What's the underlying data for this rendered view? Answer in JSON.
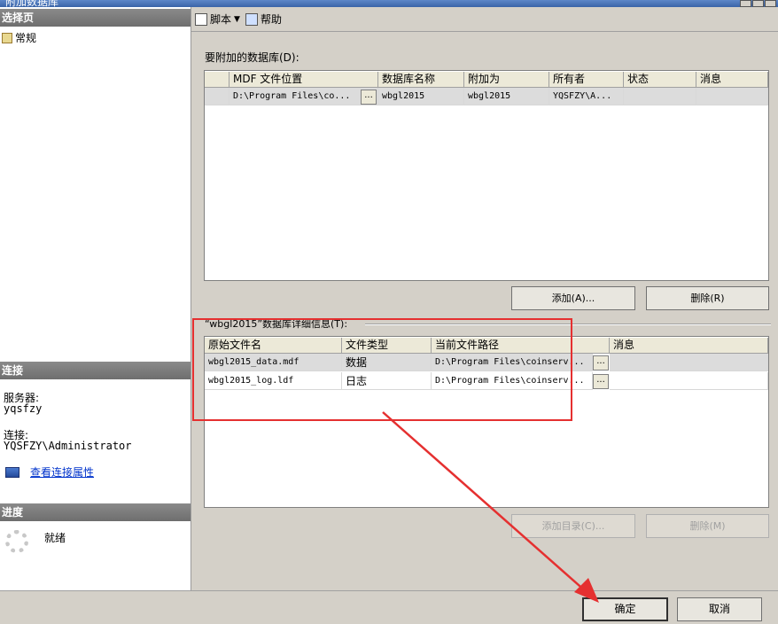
{
  "window": {
    "title": "附加数据库"
  },
  "left": {
    "select_page_header": "选择页",
    "nav_general": "常规",
    "connection_header": "连接",
    "server_label": "服务器:",
    "server_value": "yqsfzy",
    "connection_label": "连接:",
    "connection_value": "YQSFZY\\Administrator",
    "view_connection_link": "查看连接属性",
    "progress_header": "进度",
    "progress_status": "就绪"
  },
  "toolbar": {
    "script_label": "脚本",
    "help_label": "帮助"
  },
  "attach_group": {
    "label": "要附加的数据库(D):",
    "columns": [
      "MDF 文件位置",
      "数据库名称",
      "附加为",
      "所有者",
      "状态",
      "消息"
    ],
    "rows": [
      {
        "mdf": "D:\\Program Files\\co...",
        "ellipsis": "...",
        "name": "wbgl2015",
        "attach_as": "wbgl2015",
        "owner": "YQSFZY\\A...",
        "status": "",
        "message": ""
      }
    ],
    "add_button": "添加(A)...",
    "remove_button": "删除(R)"
  },
  "details_group": {
    "label": "“wbgl2015”数据库详细信息(T):",
    "columns": [
      "原始文件名",
      "文件类型",
      "当前文件路径",
      "消息"
    ],
    "rows": [
      {
        "file": "wbgl2015_data.mdf",
        "type": "数据",
        "path": "D:\\Program Files\\coinserv...",
        "ellipsis": "...",
        "message": ""
      },
      {
        "file": "wbgl2015_log.ldf",
        "type": "日志",
        "path": "D:\\Program Files\\coinserv...",
        "ellipsis": "...",
        "message": ""
      }
    ],
    "add_catalog_button": "添加目录(C)...",
    "remove_button": "删除(M)"
  },
  "footer": {
    "ok_button": "确定",
    "cancel_button": "取消"
  },
  "colors": {
    "annotation_red": "#e53030",
    "link_blue": "#0033cc"
  }
}
